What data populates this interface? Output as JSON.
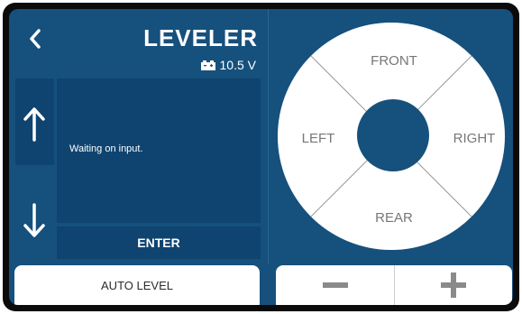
{
  "header": {
    "back_icon": "chevron-left-icon",
    "title": "LEVELER",
    "battery_icon": "battery-icon",
    "voltage": "10.5 V"
  },
  "left_panel": {
    "up_icon": "arrow-up-icon",
    "down_icon": "arrow-down-icon",
    "status": "Waiting on input.",
    "enter_label": "ENTER",
    "auto_level_label": "AUTO LEVEL"
  },
  "direction_pad": {
    "front": "FRONT",
    "left": "LEFT",
    "right": "RIGHT",
    "rear": "REAR"
  },
  "controls": {
    "minus_icon": "minus-icon",
    "plus_icon": "plus-icon"
  },
  "colors": {
    "background": "#16507c",
    "panel": "#0f4470",
    "pad": "#ffffff",
    "center_button": "#16507c"
  }
}
